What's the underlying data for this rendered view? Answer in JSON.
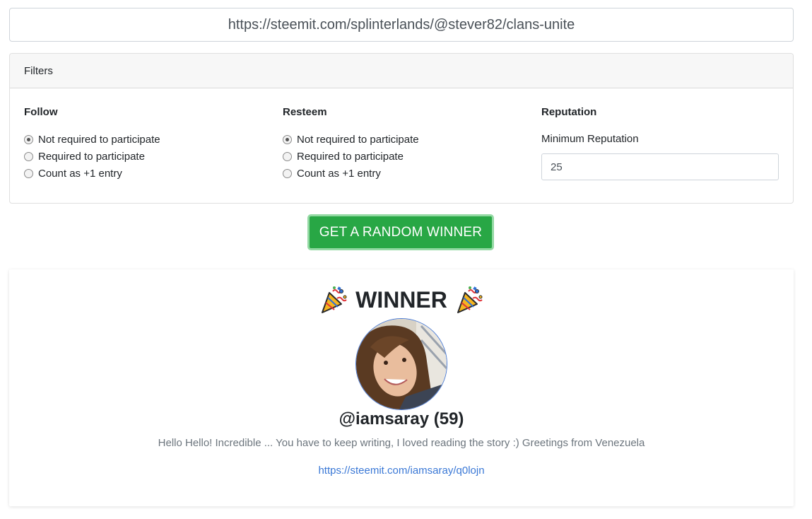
{
  "url_input": {
    "value": "https://steemit.com/splinterlands/@stever82/clans-unite"
  },
  "filters": {
    "header": "Filters",
    "follow": {
      "title": "Follow",
      "options": [
        {
          "label": "Not required to participate",
          "checked": true
        },
        {
          "label": "Required to participate",
          "checked": false
        },
        {
          "label": "Count as +1 entry",
          "checked": false
        }
      ]
    },
    "resteem": {
      "title": "Resteem",
      "options": [
        {
          "label": "Not required to participate",
          "checked": true
        },
        {
          "label": "Required to participate",
          "checked": false
        },
        {
          "label": "Count as +1 entry",
          "checked": false
        }
      ]
    },
    "reputation": {
      "title": "Reputation",
      "label": "Minimum Reputation",
      "value": "25"
    }
  },
  "button": {
    "label": "GET A RANDOM WINNER",
    "color": "#28a745"
  },
  "winner": {
    "heading": "WINNER",
    "icon": "party-popper-icon",
    "name": "@iamsaray (59)",
    "comment": "Hello Hello! Incredible ... You have to keep writing, I loved reading the story :) Greetings from Venezuela",
    "link": "https://steemit.com/iamsaray/q0lojn"
  }
}
